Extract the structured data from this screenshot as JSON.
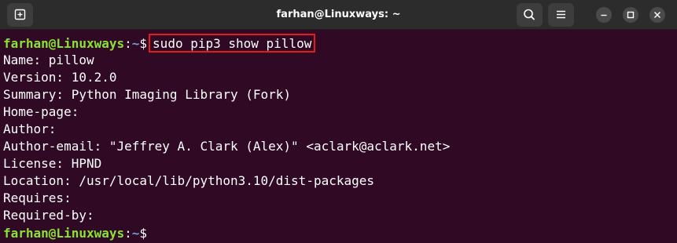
{
  "window": {
    "title": "farhan@Linuxways: ~"
  },
  "icons": {
    "new_tab": "new-tab-icon",
    "search": "search-icon",
    "menu": "hamburger-menu-icon",
    "minimize": "minimize-icon",
    "maximize": "maximize-icon",
    "close": "close-icon"
  },
  "prompt": {
    "user_host": "farhan@Linuxways",
    "colon": ":",
    "path": "~",
    "symbol": "$"
  },
  "command": "sudo pip3 show pillow",
  "output": [
    "Name: pillow",
    "Version: 10.2.0",
    "Summary: Python Imaging Library (Fork)",
    "Home-page:",
    "Author:",
    "Author-email: \"Jeffrey A. Clark (Alex)\" <aclark@aclark.net>",
    "License: HPND",
    "Location: /usr/local/lib/python3.10/dist-packages",
    "Requires:",
    "Required-by:"
  ],
  "colors": {
    "background": "#300a24",
    "prompt_user": "#8ae234",
    "prompt_path": "#729fcf",
    "highlight_box": "#e41b1b"
  }
}
